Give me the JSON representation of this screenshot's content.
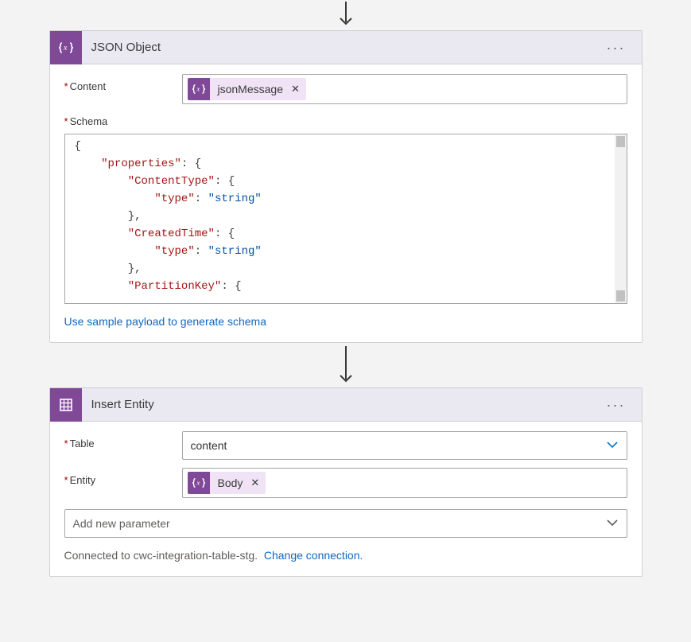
{
  "json_object": {
    "title": "JSON Object",
    "content_label": "Content",
    "content_token": "jsonMessage",
    "schema_label": "Schema",
    "schema_lines": [
      {
        "indent": 0,
        "raw": "{"
      },
      {
        "indent": 1,
        "key": "properties",
        "after": ": {"
      },
      {
        "indent": 2,
        "key": "ContentType",
        "after": ": {"
      },
      {
        "indent": 3,
        "key": "type",
        "after": ": ",
        "val": "string"
      },
      {
        "indent": 2,
        "raw": "},"
      },
      {
        "indent": 2,
        "key": "CreatedTime",
        "after": ": {"
      },
      {
        "indent": 3,
        "key": "type",
        "after": ": ",
        "val": "string"
      },
      {
        "indent": 2,
        "raw": "},"
      },
      {
        "indent": 2,
        "key": "PartitionKey",
        "after": ": {"
      }
    ],
    "sample_link": "Use sample payload to generate schema"
  },
  "insert_entity": {
    "title": "Insert Entity",
    "table_label": "Table",
    "table_value": "content",
    "entity_label": "Entity",
    "entity_token": "Body",
    "add_param_placeholder": "Add new parameter",
    "connected_text": "Connected to cwc-integration-table-stg.",
    "change_link": "Change connection."
  }
}
